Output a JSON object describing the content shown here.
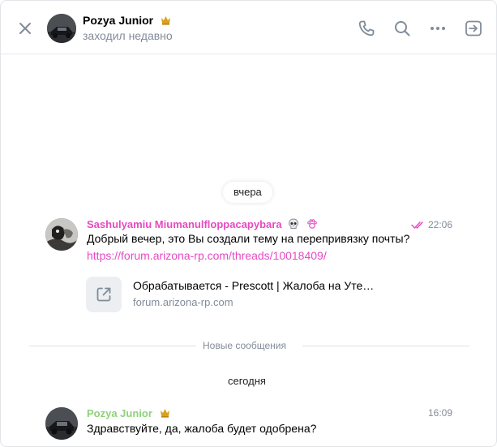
{
  "header": {
    "peer_name": "Pozya Junior",
    "peer_status": "заходил недавно"
  },
  "dates": {
    "yesterday": "вчера",
    "today": "сегодня"
  },
  "messages": [
    {
      "author": "Sashulyamiu Miumanulfloppacapybara",
      "author_color": "#e64ac2",
      "time": "22:06",
      "text": "Добрый вечер, это Вы создали тему на перепривязку почты?",
      "link": "https://forum.arizona-rp.com/threads/10018409/",
      "snippet": {
        "title": "Обрабатывается - Prescott | Жалоба на Уте…",
        "domain": "forum.arizona-rp.com"
      }
    },
    {
      "author": "Pozya Junior",
      "author_color": "#8ed17a",
      "time": "16:09",
      "text": "Здравствуйте, да, жалоба будет одобрена?"
    }
  ],
  "divider": {
    "label": "Новые сообщения"
  },
  "colors": {
    "accent": "#e64ac2",
    "muted": "#818c99",
    "icon": "#818c99"
  }
}
